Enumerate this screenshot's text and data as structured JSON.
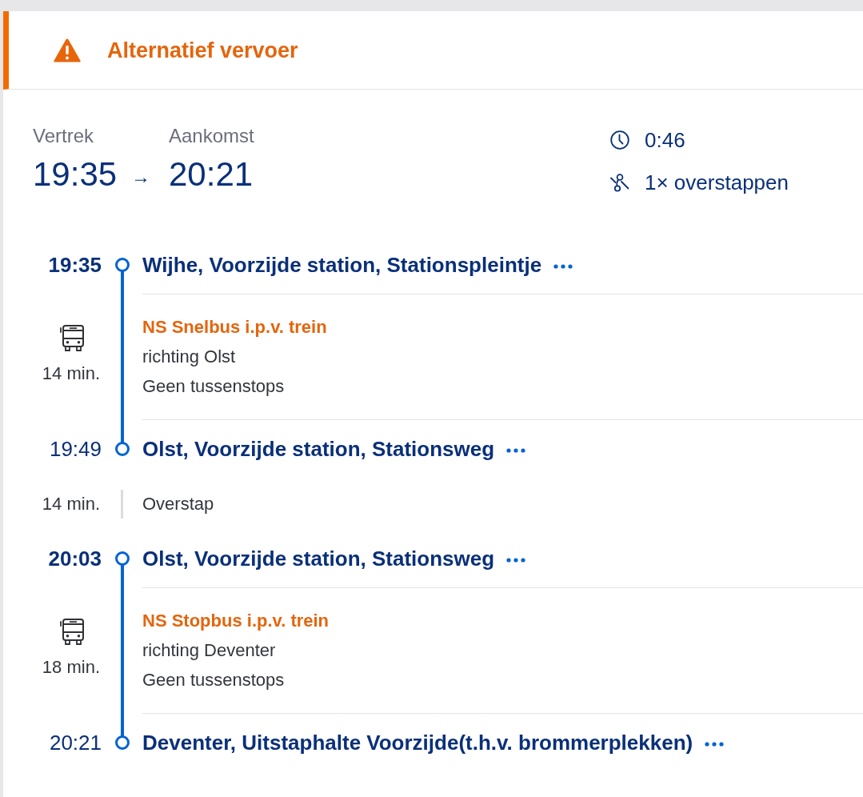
{
  "alert": {
    "title": "Alternatief vervoer"
  },
  "summary": {
    "departure": {
      "label": "Vertrek",
      "time": "19:35"
    },
    "arrow": "→",
    "arrival": {
      "label": "Aankomst",
      "time": "20:21"
    },
    "duration": "0:46",
    "transfers": "1× overstappen"
  },
  "timeline": [
    {
      "kind": "departure",
      "time": "19:35",
      "station": "Wijhe, Voorzijde station, Stationspleintje"
    },
    {
      "kind": "ride",
      "duration": "14 min.",
      "service": "NS Snelbus i.p.v. trein",
      "direction": "richting Olst",
      "stops": "Geen tussenstops"
    },
    {
      "kind": "arrival",
      "time": "19:49",
      "station": "Olst, Voorzijde station, Stationsweg"
    },
    {
      "kind": "transfer",
      "duration": "14 min.",
      "label": "Overstap"
    },
    {
      "kind": "departure",
      "time": "20:03",
      "station": "Olst, Voorzijde station, Stationsweg"
    },
    {
      "kind": "ride",
      "duration": "18 min.",
      "service": "NS Stopbus i.p.v. trein",
      "direction": "richting Deventer",
      "stops": "Geen tussenstops"
    },
    {
      "kind": "arrival",
      "time": "20:21",
      "station": "Deventer, Uitstaphalte Voorzijde(t.h.v. brommerplekken)"
    }
  ]
}
